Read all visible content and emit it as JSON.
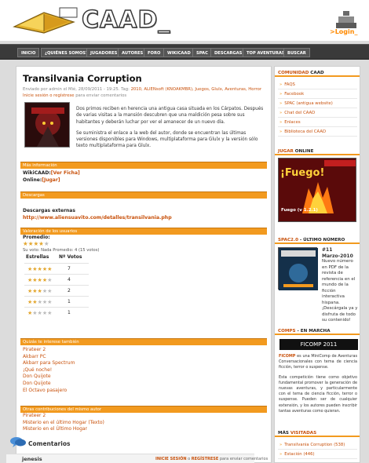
{
  "header": {
    "logo_text": "CAAD_",
    "login_label": ">Login_"
  },
  "nav": [
    "INICIO",
    "¿QUIÉNES SOMOS?",
    "JUGADORES",
    "AUTORES",
    "FORO",
    "WIKICAAD",
    "SPAC",
    "DESCARGAS",
    "TOP AVENTURAS",
    "BUSCAR"
  ],
  "post": {
    "title": "Transilvania Corruption",
    "meta_pre": "Enviado por admin el Mié, 28/09/2011 - 19:25.  Tag:",
    "meta_tags": "2010, ALIENsoft (KNOAKMBR), Juegos, Glulx, Aventuras, Horror",
    "meta_link": "Inicie sesión o regístrese",
    "meta_post": " para enviar comentarios",
    "desc_1": "Dos primos reciben en herencia una antigua casa situada en los Cárpatos. Después de varias visitas a la mansión descubren que una maldición pesa sobre sus habitantes y deberán luchar por ver el amanecer de un nuevo día.",
    "desc_2": "Se suministra el enlace a la web del autor, donde se encuentran las últimas versiones disponibles para Windows, multiplataforma para Glulx y la versión sólo texto multiplataforma para Glulx."
  },
  "sections": {
    "info": "Más información",
    "descargas": "Descargas",
    "valoracion": "Valoración de los usuarios",
    "tambien": "Quizás te interese también",
    "otras": "Otras contribuciones del mismo autor"
  },
  "info": {
    "wiki_label": "WikiCAAD:",
    "wiki_link": "[Ver Ficha]",
    "online_label": "Online:",
    "online_link": "[Jugar]"
  },
  "download": {
    "label": "Descargas externas",
    "url": "http://www.aliensuavito.com/detalles/transilvania.php"
  },
  "rating": {
    "promedio_label": "Promedio:",
    "your_vote": "Su voto: Nada Promedio: 4 (15 votos)",
    "col_stars": "Estrellas",
    "col_votes": "Nº Votos",
    "rows": [
      {
        "stars": 5,
        "votes": "7"
      },
      {
        "stars": 4,
        "votes": "4"
      },
      {
        "stars": 3,
        "votes": "2"
      },
      {
        "stars": 2,
        "votes": "1"
      },
      {
        "stars": 1,
        "votes": "1"
      }
    ]
  },
  "related": [
    "Pirateer 2",
    "Akbarr PC",
    "Akbarr para Spectrum",
    "¡Qué noche!",
    "Don Quijote",
    "Don Quijote",
    "El Octavo pasajero"
  ],
  "same_author": [
    "Pirateer 2",
    "Misterio en el último Hogar (Texto)",
    "Misterio en el Último Hogar"
  ],
  "comments": {
    "title": "Comentarios",
    "user": "jenesis",
    "login_b1": "INICIE SESIÓN",
    "login_mid": " o ",
    "login_b2": "REGÍSTRESE",
    "login_tail": " para enviar comentarios"
  },
  "sidebar": {
    "comunidad_h1": "COMUNIDAD ",
    "comunidad_h2": "CAAD",
    "comunidad_items": [
      "FAQS",
      "Facebook",
      "SPAC (antigua website)",
      "Chat del CAAD",
      "Enlaces",
      "Biblioteca del CAAD"
    ],
    "jugar_h1": "JUGAR",
    "jugar_h2": " ONLINE",
    "jugar_caption": "Fuego (v 1.2.1)",
    "spac_h1": "SPAC2.0",
    "spac_h2": " - ÚLTIMO NÚMERO",
    "spac_num": "#11",
    "spac_date": "Marzo-2010",
    "spac_text": "Nuevo número en PDF de la revista de referencia en el mundo de la ficción interactiva hispana. ¡Descárgala ya y disfruta de todo su contenido!",
    "comps_h1": "COMPS",
    "comps_h2": " - EN MARCHA",
    "ficomp_banner": "FICOMP 2011",
    "ficomp_b": "FICOMP",
    "ficomp_t1": " es una MiniComp de Aventuras Conversacionales con tema de ciencia ficción, terror o suspense.",
    "ficomp_t2": "Esta competición tiene como objetivo fundamental promover la generación de nuevas aventuras, y particularmente con el tema de ciencia ficción, terror o suspense. Pueden ser de cualquier extensión, y los autores pueden inscribir tantas aventuras como quieran.",
    "visitadas_h1": "MÁS ",
    "visitadas_h2": "VISITADAS",
    "visitadas_items": [
      "Transilvania Corruption (538)",
      "Estación (446)"
    ]
  },
  "colors": {
    "accent": "#f29a1f",
    "link": "#c8500a",
    "nav": "#3a3a3a"
  }
}
